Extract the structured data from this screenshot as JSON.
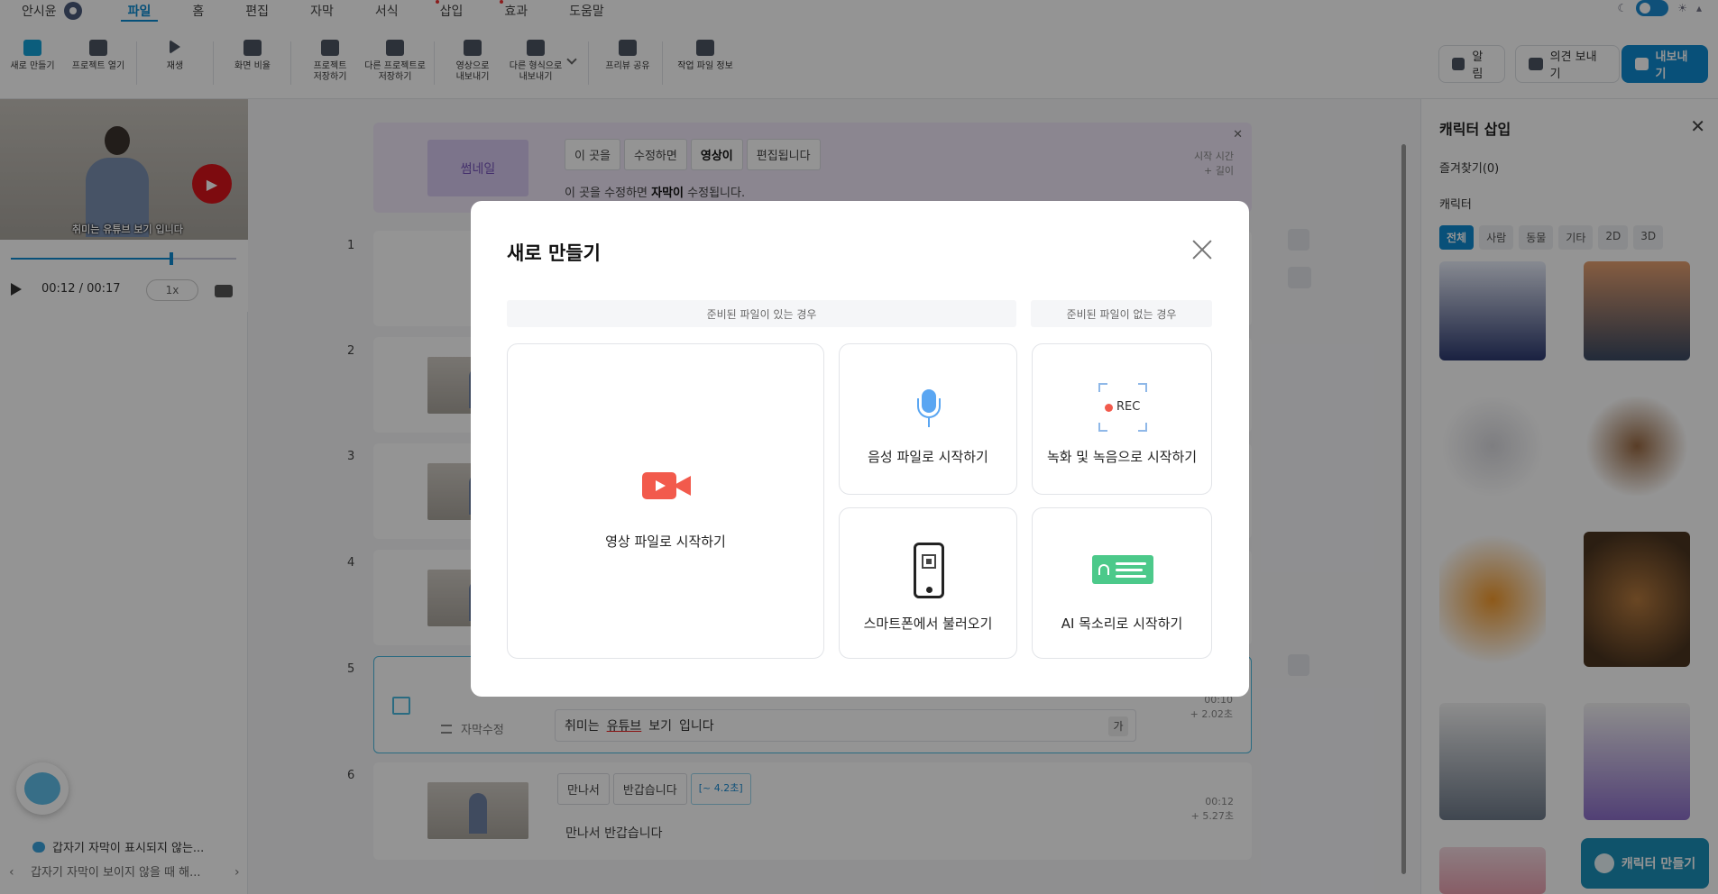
{
  "menubar": {
    "user_name": "안시윤",
    "items": [
      {
        "label": "파일",
        "active": true,
        "dot": false
      },
      {
        "label": "홈",
        "active": false,
        "dot": false
      },
      {
        "label": "편집",
        "active": false,
        "dot": false
      },
      {
        "label": "자막",
        "active": false,
        "dot": false
      },
      {
        "label": "서식",
        "active": false,
        "dot": false
      },
      {
        "label": "삽입",
        "active": false,
        "dot": true
      },
      {
        "label": "효과",
        "active": false,
        "dot": true
      },
      {
        "label": "도움말",
        "active": false,
        "dot": false
      }
    ]
  },
  "toolbar": {
    "new": "새로 만들기",
    "open": "프로젝트 열기",
    "play": "재생",
    "ratio": "화면 비율",
    "save_1": "프로젝트",
    "save_2": "저장하기",
    "saveas_1": "다른 프로젝트로",
    "saveas_2": "저장하기",
    "export_video_1": "영상으로",
    "export_video_2": "내보내기",
    "export_other_1": "다른 형식으로",
    "export_other_2": "내보내기",
    "share": "프리뷰 공유",
    "info": "작업 파일 정보",
    "alarm": "알림",
    "feedback": "의견 보내기",
    "export": "내보내기"
  },
  "player": {
    "caption": "취미는 유튜브 보기 입니다",
    "time": "00:12 / 00:17",
    "speed": "1x",
    "progress_fraction": 0.71
  },
  "notice": {
    "question": "갑자기 자막이 표시되지 않는...",
    "answer": "갑자기 자막이 보이지 않을 때 해..."
  },
  "editor": {
    "thumbnail_label": "썸네일",
    "thumb_chips": [
      "이 곳을",
      "수정하면",
      "영상이",
      "편집됩니다"
    ],
    "thumb_sub_pre": "이 곳을 수정하면",
    "thumb_sub_bold": "자막이",
    "thumb_sub_post": "수정됩니다.",
    "thumb_meta_1": "시작 시간",
    "thumb_meta_2": "+ 길이",
    "rows": [
      "1",
      "2",
      "3",
      "4",
      "5",
      "6"
    ],
    "row5_edit_label": "자막수정",
    "row5_sub_1": "취미는",
    "row5_sub_2": "유튜브",
    "row5_sub_3": "보기",
    "row5_sub_4": "입니다",
    "row5_ga": "가",
    "row5_meta_1": "00:10",
    "row5_meta_2": "+ 2.02초",
    "row6_chips": [
      "만나서",
      "반갑습니다"
    ],
    "row6_time_chip": "[~ 4.2초]",
    "row6_sub": "만나서 반갑습니다",
    "row6_meta_1": "00:12",
    "row6_meta_2": "+ 5.27초"
  },
  "right_panel": {
    "title": "캐릭터 삽입",
    "favorites": "즐겨찾기(0)",
    "section": "캐릭터",
    "tabs": [
      "전체",
      "사람",
      "동물",
      "기타",
      "2D",
      "3D"
    ],
    "make_button": "캐릭터 만들기"
  },
  "modal": {
    "title": "새로 만들기",
    "header_with_file": "준비된 파일이 있는 경우",
    "header_without_file": "준비된 파일이 없는 경우",
    "opt_video": "영상 파일로 시작하기",
    "opt_audio": "음성 파일로 시작하기",
    "opt_record": "녹화 및 녹음으로 시작하기",
    "rec_text": "REC",
    "opt_phone": "스마트폰에서 불러오기",
    "opt_ai": "AI 목소리로 시작하기"
  },
  "colors": {
    "accent": "#0e8bd1",
    "video_icon": "#f25a4c",
    "mic_icon": "#5aa6f2",
    "ai_icon": "#4cc98a"
  }
}
